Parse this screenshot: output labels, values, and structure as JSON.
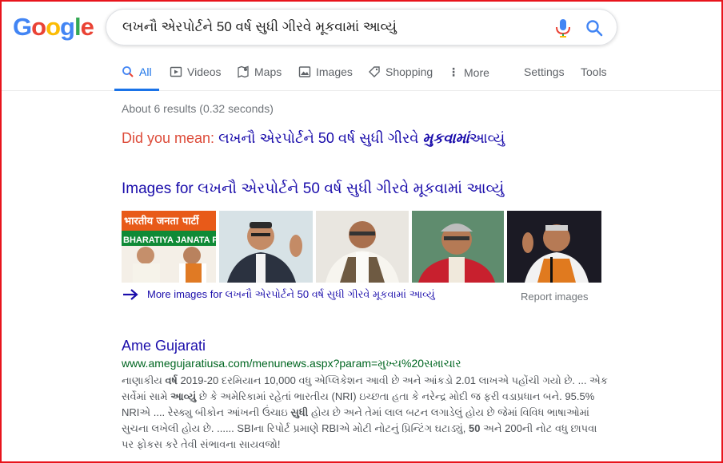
{
  "logo": {
    "letters": [
      "G",
      "o",
      "o",
      "g",
      "l",
      "e"
    ],
    "colors": [
      "#4285F4",
      "#EA4335",
      "#FBBC05",
      "#4285F4",
      "#34A853",
      "#EA4335"
    ]
  },
  "search": {
    "query": "લખનૌ એરપોર્ટને 50 વર્ષ સુધી ગીરવે મૂકવામાં આવ્યું",
    "mic_icon": "mic-icon",
    "search_icon": "search-icon"
  },
  "tabs": {
    "all": "All",
    "videos": "Videos",
    "maps": "Maps",
    "images": "Images",
    "shopping": "Shopping",
    "more": "More",
    "settings": "Settings",
    "tools": "Tools"
  },
  "stats": "About 6 results (0.32 seconds)",
  "did_you_mean": {
    "label": "Did you mean:",
    "prefix": "લખનૌ એરપોર્ટને 50 વર્ષ સુધી ગીરવે",
    "bold": "મુકવામાં",
    "suffix": "આવ્યું"
  },
  "images_section": {
    "heading": "Images for લખનૌ એરપોર્ટને 50 વર્ષ સુધી ગીરવે મૂકવામાં આવ્યું",
    "more_link": "More images for લખનૌ એરપોર્ટને 50 વર્ષ સુધી ગીરવે મૂકવામાં આવ્યું",
    "report": "Report images",
    "banner_text": "भारतीय जनता पार्टी",
    "banner_text2": "BHARATIYA JANATA P"
  },
  "result": {
    "title": "Ame Gujarati",
    "url": "www.amegujaratiusa.com/menunews.aspx?param=મુખ્ય%20સમાચાર",
    "lines": [
      [
        {
          "t": "નાણાકીય "
        },
        {
          "t": "વર્ષ",
          "b": true
        },
        {
          "t": " 2019-20 દરમિયાન 10,000 વધુ એપ્લિકેશન આવી છે અને આંકડો 2.01 લાખએ પહોંચી ગયો છે. ... એક"
        }
      ],
      [
        {
          "t": "સર્વેમાં સામે "
        },
        {
          "t": "આવ્યું",
          "b": true
        },
        {
          "t": " છે કે અમેરિકામાં રહેતાં ભારતીય (NRI) ઇચ્છતા હતા કે નરેન્દ્ર મોદી જ ફરી વડાપ્રધાન બને. 95.5%"
        }
      ],
      [
        {
          "t": "NRIએ .... રેસ્ક્યુ બીકોન આંખની ઉંચાઇ "
        },
        {
          "t": "સુધી",
          "b": true
        },
        {
          "t": " હોય છે અને તેમાં લાલ બટન લગાડેલું હોય છે જેમાં વિવિધ ભાષાઓમાં"
        }
      ],
      [
        {
          "t": "સુચના લખેલી હોય છે. ...... SBIના રિપોર્ટ પ્રમાણે RBIએ મોટી નોટનું પ્રિન્ટિંગ ઘટાડ્યું, "
        },
        {
          "t": "50",
          "b": true
        },
        {
          "t": " અને 200ની નોટ વધુ છાપવા"
        }
      ],
      [
        {
          "t": "પર ફોકસ કરે તેવી સંભાવના સાયવજો!"
        }
      ]
    ]
  }
}
